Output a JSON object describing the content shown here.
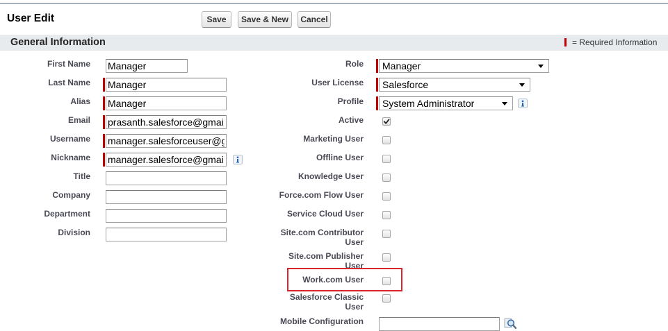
{
  "page": {
    "title": "User Edit"
  },
  "toolbar": {
    "save_label": "Save",
    "save_new_label": "Save & New",
    "cancel_label": "Cancel"
  },
  "section": {
    "title": "General Information",
    "required_legend": "= Required Information"
  },
  "left_fields": [
    {
      "label": "First Name",
      "value": "Manager",
      "required": false
    },
    {
      "label": "Last Name",
      "value": "Manager",
      "required": true
    },
    {
      "label": "Alias",
      "value": "Manager",
      "required": true
    },
    {
      "label": "Email",
      "value": "prasanth.salesforce@gmai",
      "required": true
    },
    {
      "label": "Username",
      "value": "manager.salesforceuser@g",
      "required": true
    },
    {
      "label": "Nickname",
      "value": "manager.salesforce@gmai",
      "required": true,
      "icon": "info-icon"
    },
    {
      "label": "Title",
      "value": "",
      "required": false
    },
    {
      "label": "Company",
      "value": "",
      "required": false
    },
    {
      "label": "Department",
      "value": "",
      "required": false
    },
    {
      "label": "Division",
      "value": "",
      "required": false
    }
  ],
  "right_fields": {
    "role": {
      "label": "Role",
      "value": "Manager",
      "required": true
    },
    "user_license": {
      "label": "User License",
      "value": "Salesforce",
      "required": true
    },
    "profile": {
      "label": "Profile",
      "value": "System Administrator",
      "required": true,
      "icon": "info-icon"
    },
    "checkboxes": [
      {
        "label": "Active",
        "checked": true
      },
      {
        "label": "Marketing User",
        "checked": false
      },
      {
        "label": "Offline User",
        "checked": false
      },
      {
        "label": "Knowledge User",
        "checked": false
      },
      {
        "label": "Force.com Flow User",
        "checked": false
      },
      {
        "label": "Service Cloud User",
        "checked": false
      },
      {
        "label": "Site.com Contributor User",
        "checked": false
      },
      {
        "label": "Site.com Publisher User",
        "checked": false
      },
      {
        "label": "Work.com User",
        "checked": false,
        "highlighted": true
      },
      {
        "label": "Salesforce Classic User",
        "checked": false
      }
    ],
    "mobile_configuration": {
      "label": "Mobile Configuration",
      "value": "",
      "icon": "lookup-icon"
    }
  },
  "colors": {
    "required_bar": "#c00000",
    "highlight_box": "#d9262c",
    "label_text": "#4a4a56",
    "section_header_bg": "#e8ebee"
  }
}
